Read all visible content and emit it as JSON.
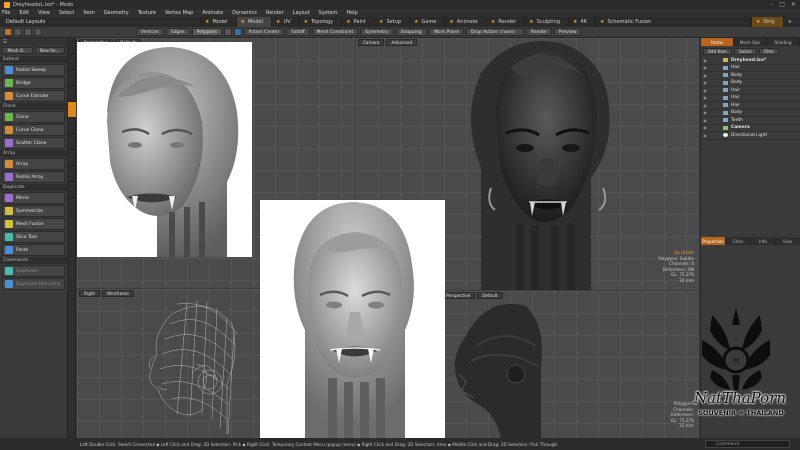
{
  "window": {
    "title": "DreyheadoL.lxo* - Modo"
  },
  "menus": [
    "File",
    "Edit",
    "View",
    "Select",
    "Item",
    "Geometry",
    "Texture",
    "Vertex Map",
    "Animate",
    "Dynamics",
    "Render",
    "Layout",
    "System",
    "Help"
  ],
  "layout": {
    "name": "Default Layouts",
    "tabs": [
      {
        "label": "Model",
        "active": false
      },
      {
        "label": "Model",
        "active": true
      },
      {
        "label": "UV",
        "active": false
      },
      {
        "label": "Topology",
        "active": false
      },
      {
        "label": "Paint",
        "active": false
      },
      {
        "label": "Setup",
        "active": false
      },
      {
        "label": "Game",
        "active": false
      },
      {
        "label": "Animate",
        "active": false
      },
      {
        "label": "Render",
        "active": false
      },
      {
        "label": "Sculpting",
        "active": false
      },
      {
        "label": "4K",
        "active": false
      },
      {
        "label": "Schematic Fusion",
        "active": false
      }
    ],
    "right_tab": "Only",
    "add_icon": "+"
  },
  "toolbar": {
    "modes": [
      "Vertices",
      "Edges",
      "Polygons"
    ],
    "buttons": [
      "Action Center",
      "Falloff",
      "Mesh Constraint",
      "Symmetry",
      "Snapping",
      "Work Plane"
    ],
    "drop_action": "Drop Action: (none)",
    "render": "Render",
    "preview": "Preview"
  },
  "left_tools": {
    "top_buttons": [
      "Mesh O...",
      "New Ite..."
    ],
    "sections": [
      {
        "title": "Extend",
        "tools": [
          "Radial Sweep",
          "Bridge",
          "Curve Extrude"
        ]
      },
      {
        "title": "Clone",
        "tools": [
          "Clone",
          "Curve Clone",
          "Scatter Clone"
        ]
      },
      {
        "title": "Array",
        "tools": [
          "Array",
          "Radial Array"
        ]
      },
      {
        "title": "Duplicate",
        "tools": [
          "Mirror",
          "Symmetrize"
        ]
      },
      {
        "title": "",
        "tools": [
          "Mesh Fusion",
          "Slice Tool",
          "Paste"
        ]
      },
      {
        "title": "Commands",
        "tools": [
          "Duplicate",
          "Duplicate Hierarchy"
        ]
      }
    ]
  },
  "viewports": {
    "top_left": {
      "view": "Perspective",
      "mode": "Default"
    },
    "bottom_left": {
      "view": "Right",
      "mode": "Wireframe"
    },
    "top_right": {
      "view": "Camera",
      "mode": "Advanced"
    },
    "bottom_right": {
      "view": "Perspective",
      "mode": "Default"
    }
  },
  "info_top": {
    "title": "Up Orient",
    "lines": [
      "Polygons: Subdiv",
      "Channels: 0",
      "Deformers: ON",
      "GL: 75,376",
      "32 mm"
    ]
  },
  "info_bottom": {
    "lines": [
      "Polygons:",
      "Channels:",
      "Deformers:",
      "GL: 75,376",
      "32 mm"
    ]
  },
  "items_panel": {
    "tabs": [
      "Items",
      "Mesh Ops",
      "Shading"
    ],
    "buttons": [
      "Add Item",
      "Select",
      "Filter"
    ],
    "items": [
      {
        "name": "Dreyhead.lxo*",
        "type": "grp",
        "bold": true
      },
      {
        "name": "Hair",
        "type": "mesh",
        "bold": false
      },
      {
        "name": "Body",
        "type": "mesh",
        "bold": false
      },
      {
        "name": "Body",
        "type": "mesh",
        "bold": false
      },
      {
        "name": "Hair",
        "type": "mesh",
        "bold": false
      },
      {
        "name": "Hair",
        "type": "mesh",
        "bold": false
      },
      {
        "name": "Hair",
        "type": "mesh",
        "bold": false
      },
      {
        "name": "Body",
        "type": "mesh",
        "bold": false
      },
      {
        "name": "Teeth",
        "type": "mesh",
        "bold": false
      },
      {
        "name": "Camera",
        "type": "cam",
        "bold": true
      },
      {
        "name": "Directional Light",
        "type": "light",
        "bold": false
      }
    ],
    "lower_tabs": [
      "Properties",
      "Chan",
      "Info",
      "User"
    ]
  },
  "status": {
    "hint": "Left Double Click: Select Connected ◆ Left Click and Drag: 2D Selection: Pick ◆ Right Click: Temporary Context Menu (popup menu) ◆ Right Click and Drag: 2D Selection: Area ◆ Middle Click and Drag: 2D Selection: Pick Through",
    "command_placeholder": "Command"
  },
  "watermark": {
    "name": "NatThaPorn",
    "sub": "SOUVENIR ❖ THAILAND"
  },
  "colors": {
    "accent": "#e08a1e",
    "bg": "#3a3a3a",
    "viewport": "#4a4a4a"
  }
}
